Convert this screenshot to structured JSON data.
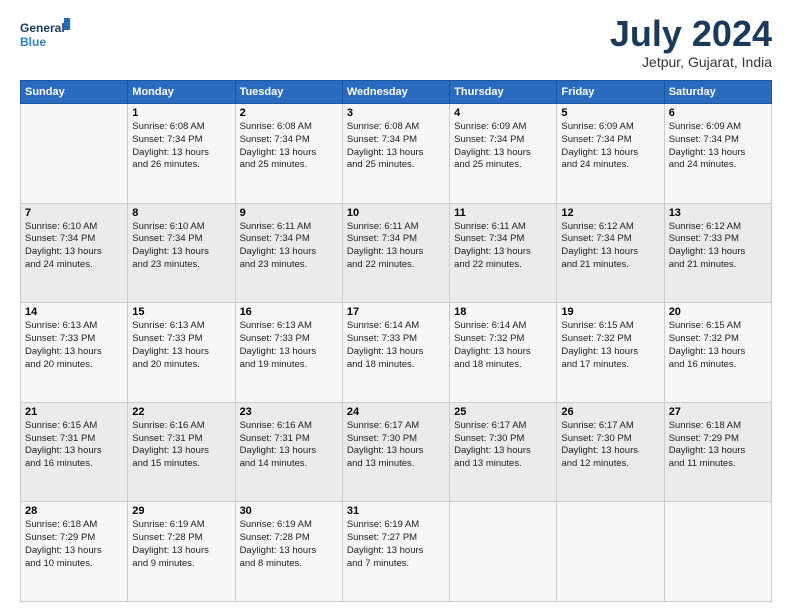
{
  "header": {
    "logo_line1": "General",
    "logo_line2": "Blue",
    "title": "July 2024",
    "location": "Jetpur, Gujarat, India"
  },
  "days_of_week": [
    "Sunday",
    "Monday",
    "Tuesday",
    "Wednesday",
    "Thursday",
    "Friday",
    "Saturday"
  ],
  "weeks": [
    [
      {
        "day": "",
        "info": ""
      },
      {
        "day": "1",
        "info": "Sunrise: 6:08 AM\nSunset: 7:34 PM\nDaylight: 13 hours\nand 26 minutes."
      },
      {
        "day": "2",
        "info": "Sunrise: 6:08 AM\nSunset: 7:34 PM\nDaylight: 13 hours\nand 25 minutes."
      },
      {
        "day": "3",
        "info": "Sunrise: 6:08 AM\nSunset: 7:34 PM\nDaylight: 13 hours\nand 25 minutes."
      },
      {
        "day": "4",
        "info": "Sunrise: 6:09 AM\nSunset: 7:34 PM\nDaylight: 13 hours\nand 25 minutes."
      },
      {
        "day": "5",
        "info": "Sunrise: 6:09 AM\nSunset: 7:34 PM\nDaylight: 13 hours\nand 24 minutes."
      },
      {
        "day": "6",
        "info": "Sunrise: 6:09 AM\nSunset: 7:34 PM\nDaylight: 13 hours\nand 24 minutes."
      }
    ],
    [
      {
        "day": "7",
        "info": "Sunrise: 6:10 AM\nSunset: 7:34 PM\nDaylight: 13 hours\nand 24 minutes."
      },
      {
        "day": "8",
        "info": "Sunrise: 6:10 AM\nSunset: 7:34 PM\nDaylight: 13 hours\nand 23 minutes."
      },
      {
        "day": "9",
        "info": "Sunrise: 6:11 AM\nSunset: 7:34 PM\nDaylight: 13 hours\nand 23 minutes."
      },
      {
        "day": "10",
        "info": "Sunrise: 6:11 AM\nSunset: 7:34 PM\nDaylight: 13 hours\nand 22 minutes."
      },
      {
        "day": "11",
        "info": "Sunrise: 6:11 AM\nSunset: 7:34 PM\nDaylight: 13 hours\nand 22 minutes."
      },
      {
        "day": "12",
        "info": "Sunrise: 6:12 AM\nSunset: 7:34 PM\nDaylight: 13 hours\nand 21 minutes."
      },
      {
        "day": "13",
        "info": "Sunrise: 6:12 AM\nSunset: 7:33 PM\nDaylight: 13 hours\nand 21 minutes."
      }
    ],
    [
      {
        "day": "14",
        "info": "Sunrise: 6:13 AM\nSunset: 7:33 PM\nDaylight: 13 hours\nand 20 minutes."
      },
      {
        "day": "15",
        "info": "Sunrise: 6:13 AM\nSunset: 7:33 PM\nDaylight: 13 hours\nand 20 minutes."
      },
      {
        "day": "16",
        "info": "Sunrise: 6:13 AM\nSunset: 7:33 PM\nDaylight: 13 hours\nand 19 minutes."
      },
      {
        "day": "17",
        "info": "Sunrise: 6:14 AM\nSunset: 7:33 PM\nDaylight: 13 hours\nand 18 minutes."
      },
      {
        "day": "18",
        "info": "Sunrise: 6:14 AM\nSunset: 7:32 PM\nDaylight: 13 hours\nand 18 minutes."
      },
      {
        "day": "19",
        "info": "Sunrise: 6:15 AM\nSunset: 7:32 PM\nDaylight: 13 hours\nand 17 minutes."
      },
      {
        "day": "20",
        "info": "Sunrise: 6:15 AM\nSunset: 7:32 PM\nDaylight: 13 hours\nand 16 minutes."
      }
    ],
    [
      {
        "day": "21",
        "info": "Sunrise: 6:15 AM\nSunset: 7:31 PM\nDaylight: 13 hours\nand 16 minutes."
      },
      {
        "day": "22",
        "info": "Sunrise: 6:16 AM\nSunset: 7:31 PM\nDaylight: 13 hours\nand 15 minutes."
      },
      {
        "day": "23",
        "info": "Sunrise: 6:16 AM\nSunset: 7:31 PM\nDaylight: 13 hours\nand 14 minutes."
      },
      {
        "day": "24",
        "info": "Sunrise: 6:17 AM\nSunset: 7:30 PM\nDaylight: 13 hours\nand 13 minutes."
      },
      {
        "day": "25",
        "info": "Sunrise: 6:17 AM\nSunset: 7:30 PM\nDaylight: 13 hours\nand 13 minutes."
      },
      {
        "day": "26",
        "info": "Sunrise: 6:17 AM\nSunset: 7:30 PM\nDaylight: 13 hours\nand 12 minutes."
      },
      {
        "day": "27",
        "info": "Sunrise: 6:18 AM\nSunset: 7:29 PM\nDaylight: 13 hours\nand 11 minutes."
      }
    ],
    [
      {
        "day": "28",
        "info": "Sunrise: 6:18 AM\nSunset: 7:29 PM\nDaylight: 13 hours\nand 10 minutes."
      },
      {
        "day": "29",
        "info": "Sunrise: 6:19 AM\nSunset: 7:28 PM\nDaylight: 13 hours\nand 9 minutes."
      },
      {
        "day": "30",
        "info": "Sunrise: 6:19 AM\nSunset: 7:28 PM\nDaylight: 13 hours\nand 8 minutes."
      },
      {
        "day": "31",
        "info": "Sunrise: 6:19 AM\nSunset: 7:27 PM\nDaylight: 13 hours\nand 7 minutes."
      },
      {
        "day": "",
        "info": ""
      },
      {
        "day": "",
        "info": ""
      },
      {
        "day": "",
        "info": ""
      }
    ]
  ]
}
